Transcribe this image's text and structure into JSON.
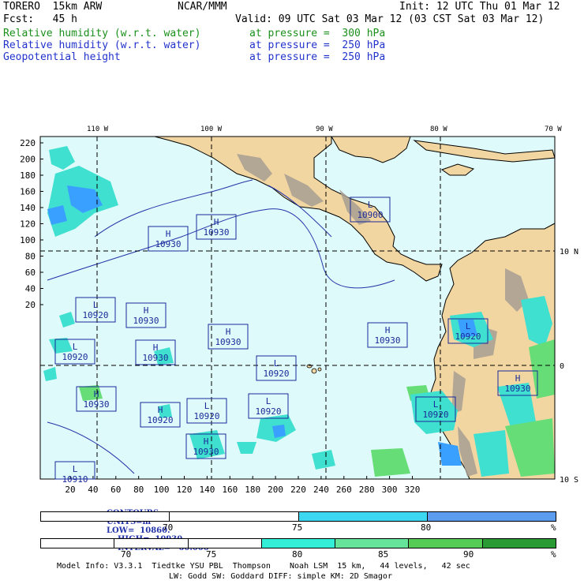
{
  "header": {
    "model": "TORERO  15km ARW",
    "center": "NCAR/MMM",
    "init": "Init: 12 UTC Thu 01 Mar 12",
    "fcst": "Fcst:   45 h",
    "valid": "Valid: 09 UTC Sat 03 Mar 12 (03 CST Sat 03 Mar 12)",
    "fields": [
      {
        "name": "Relative humidity (w.r.t. water)",
        "level": "at pressure =  300 hPa",
        "color": "#1a8f1a"
      },
      {
        "name": "Relative humidity (w.r.t. water)",
        "level": "at pressure =  250 hPa",
        "color": "#2233cc"
      },
      {
        "name": "Geopotential height",
        "level": "at pressure =  250 hPa",
        "color": "#2233cc"
      }
    ]
  },
  "map": {
    "top_lon_labels": [
      "110 W",
      "100 W",
      "90 W",
      "80 W",
      "70 W"
    ],
    "right_lat_labels": [
      "10 N",
      "0",
      "10 S"
    ],
    "left_ticks": [
      "220",
      "200",
      "180",
      "160",
      "140",
      "120",
      "100",
      "80",
      "60",
      "40",
      "20"
    ],
    "bottom_ticks": [
      "20",
      "40",
      "60",
      "80",
      "100",
      "120",
      "140",
      "160",
      "180",
      "200",
      "220",
      "240",
      "260",
      "280",
      "300",
      "320"
    ],
    "colors": {
      "ocean": "#dffafa",
      "land": "#f2d6a2",
      "terrain": "#a89e92",
      "rh_light": "#40e0d0",
      "rh_mid": "#3aa0ff",
      "rh_green": "#66dd77"
    },
    "centers": [
      {
        "type": "L",
        "value": "10900"
      },
      {
        "type": "H",
        "value": "10930"
      },
      {
        "type": "H",
        "value": "10930"
      },
      {
        "type": "L",
        "value": "10920"
      },
      {
        "type": "H",
        "value": "10930"
      },
      {
        "type": "H",
        "value": "10930"
      },
      {
        "type": "H",
        "value": "10930"
      },
      {
        "type": "L",
        "value": "10920"
      },
      {
        "type": "H",
        "value": "10930"
      },
      {
        "type": "L",
        "value": "10920"
      },
      {
        "type": "L",
        "value": "10920"
      },
      {
        "type": "H",
        "value": "10930"
      },
      {
        "type": "H",
        "value": "10920"
      },
      {
        "type": "H",
        "value": "10930"
      },
      {
        "type": "L",
        "value": "10920"
      },
      {
        "type": "L",
        "value": "10920"
      },
      {
        "type": "L",
        "value": "10920"
      },
      {
        "type": "H",
        "value": "10930"
      },
      {
        "type": "L",
        "value": "10910"
      }
    ]
  },
  "contours_line": {
    "prefix": "CONTOURS:",
    "units": "UNITS=m",
    "low": "LOW=  10860.",
    "high": "HIGH=  10930.",
    "interval": "INTERVAL=   60.000"
  },
  "colorbar1": {
    "ticks": [
      "70",
      "75",
      "80"
    ],
    "unit": "%",
    "colors": [
      "#ffffff",
      "#ffffff",
      "#3cd7f0",
      "#5b9cef"
    ]
  },
  "colorbar2": {
    "ticks": [
      "70",
      "75",
      "80",
      "85",
      "90"
    ],
    "unit": "%",
    "colors": [
      "#ffffff",
      "#ffffff",
      "#ffffff",
      "#33efd8",
      "#66e59a",
      "#55cc55",
      "#2a9a35"
    ]
  },
  "footer": {
    "line1": "Model Info: V3.3.1  Tiedtke YSU PBL  Thompson    Noah LSM  15 km,   44 levels,   42 sec",
    "line2": "LW: Godd SW: Goddard DIFF: simple KM: 2D Smagor"
  }
}
